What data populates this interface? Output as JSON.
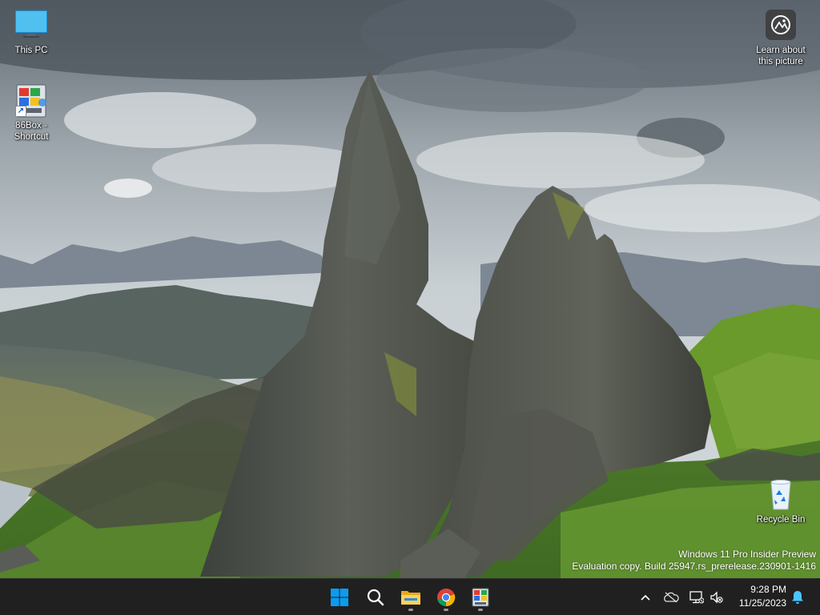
{
  "desktop": {
    "icons": [
      {
        "label": "This PC"
      },
      {
        "label": "86Box - Shortcut"
      },
      {
        "label": "Recycle Bin"
      },
      {
        "label": "Learn about this picture"
      }
    ]
  },
  "watermark": {
    "line1": "Windows 11 Pro Insider Preview",
    "line2": "Evaluation copy. Build 25947.rs_prerelease.230901-1416"
  },
  "taskbar": {
    "pinned": [
      {
        "icon": "windows-start-icon",
        "running": false
      },
      {
        "icon": "search-icon",
        "running": false
      },
      {
        "icon": "file-explorer-icon",
        "running": true
      },
      {
        "icon": "chrome-icon",
        "running": true
      },
      {
        "icon": "86box-icon",
        "running": true
      }
    ],
    "tray": {
      "icons": [
        "chevron-up-icon",
        "onedrive-icon",
        "network-icon",
        "volume-muted-icon",
        "notification-bell-icon"
      ]
    },
    "clock": {
      "time": "9:28 PM",
      "date": "11/25/2023"
    }
  },
  "colors": {
    "taskbar": "#202020",
    "start_blue": "#0a9cf0",
    "notification_blue": "#4cc2ff"
  }
}
